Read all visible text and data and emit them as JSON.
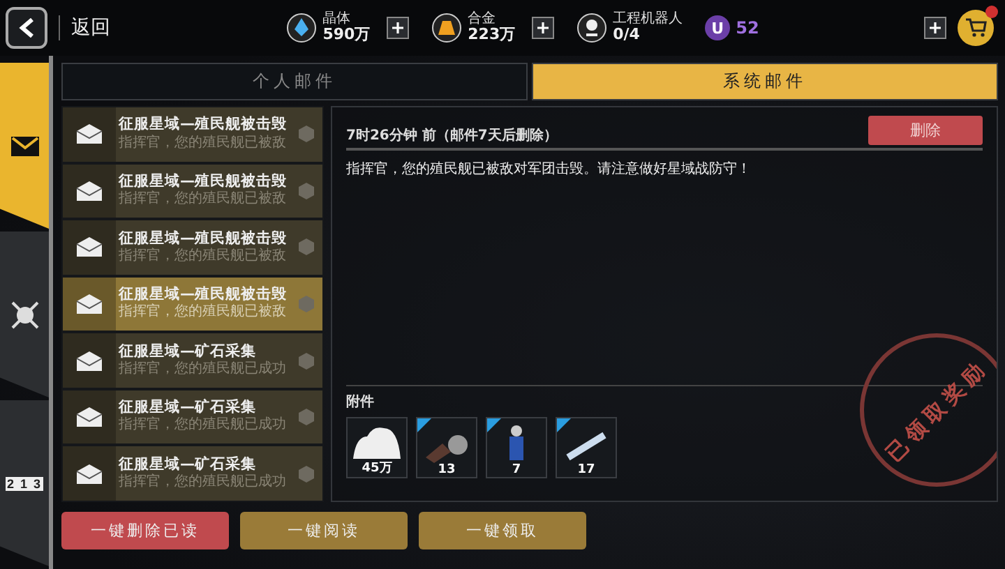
{
  "top_bar": {
    "back_label": "返回",
    "resources": [
      {
        "kind": "crystal",
        "label": "晶体",
        "value": "590万",
        "addable": true
      },
      {
        "kind": "alloy",
        "label": "合金",
        "value": "223万",
        "addable": true
      },
      {
        "kind": "robot",
        "label": "工程机器人",
        "value": "0/4"
      }
    ],
    "currency": {
      "symbol": "U",
      "value": "52",
      "addable": true
    },
    "cart_badge": true
  },
  "side_tabs": [
    {
      "kind": "mail",
      "selected": true
    },
    {
      "kind": "battle",
      "selected": false
    },
    {
      "kind": "rank",
      "selected": false,
      "digits": [
        "2",
        "1",
        "3"
      ]
    }
  ],
  "mail_tabs": [
    {
      "label": "个人邮件",
      "selected": false
    },
    {
      "label": "系统邮件",
      "selected": true
    }
  ],
  "mails": [
    {
      "title": "征服星域—殖民舰被击毁",
      "preview": "指挥官，您的殖民舰已被敌",
      "selected": false
    },
    {
      "title": "征服星域—殖民舰被击毁",
      "preview": "指挥官，您的殖民舰已被敌",
      "selected": false
    },
    {
      "title": "征服星域—殖民舰被击毁",
      "preview": "指挥官，您的殖民舰已被敌",
      "selected": false
    },
    {
      "title": "征服星域—殖民舰被击毁",
      "preview": "指挥官，您的殖民舰已被敌",
      "selected": true
    },
    {
      "title": "征服星域—矿石采集",
      "preview": "指挥官，您的殖民舰已成功",
      "selected": false
    },
    {
      "title": "征服星域—矿石采集",
      "preview": "指挥官，您的殖民舰已成功",
      "selected": false
    },
    {
      "title": "征服星域—矿石采集",
      "preview": "指挥官，您的殖民舰已成功",
      "selected": false
    }
  ],
  "detail": {
    "time": "7时26分钟 前（邮件7天后删除）",
    "delete_label": "删除",
    "body": "指挥官，您的殖民舰已被敌对军团击毁。请注意做好星域战防守！",
    "attachments_label": "附件",
    "attachments": [
      {
        "kind": "cloud",
        "count": "45万",
        "corner": false
      },
      {
        "kind": "ore",
        "count": "13",
        "corner": true
      },
      {
        "kind": "figure",
        "count": "7",
        "corner": true
      },
      {
        "kind": "rod",
        "count": "17",
        "corner": true
      }
    ],
    "stamp": "已领取奖励"
  },
  "actions": [
    {
      "label": "一键删除已读",
      "kind": "danger"
    },
    {
      "label": "一键阅读",
      "kind": "gold"
    },
    {
      "label": "一键领取",
      "kind": "gold"
    }
  ]
}
